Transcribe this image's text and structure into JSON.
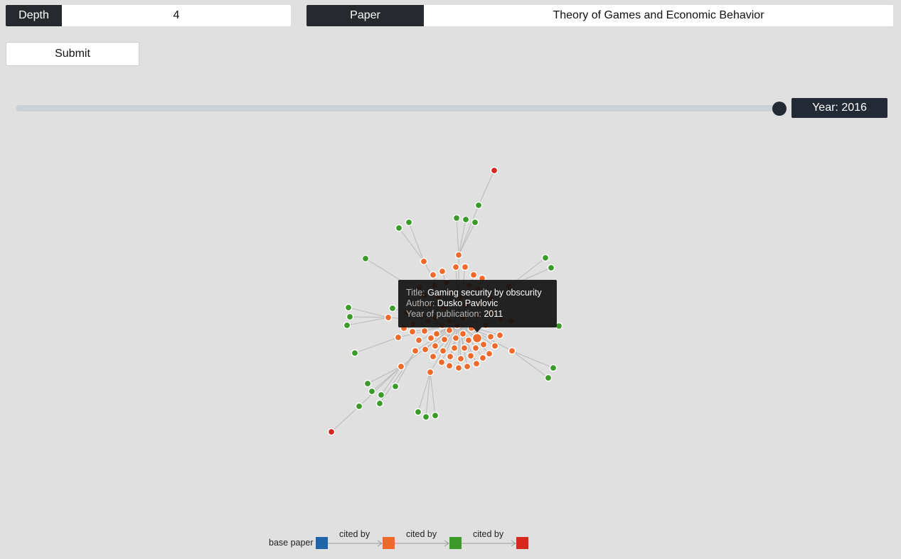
{
  "form": {
    "depth_label": "Depth",
    "depth_value": "4",
    "paper_label": "Paper",
    "paper_value": "Theory of Games and Economic Behavior",
    "submit_label": "Submit"
  },
  "slider": {
    "year_text": "Year: 2016",
    "year": 2016,
    "level": 1.0
  },
  "tooltip": {
    "title_key": "Title:",
    "title_value": "Gaming security by obscurity",
    "author_key": "Author:",
    "author_value": "Dusko Pavlovic",
    "year_key": "Year of publication:",
    "year_value": "2011"
  },
  "legend": {
    "base_label": "base paper",
    "arrow_label_1": "cited by",
    "arrow_label_2": "cited by",
    "arrow_label_3": "cited by",
    "colors": {
      "base": "#1f63a8",
      "level1": "#ef6a2a",
      "level2": "#3b9a2a",
      "level3": "#d7281e"
    }
  }
}
